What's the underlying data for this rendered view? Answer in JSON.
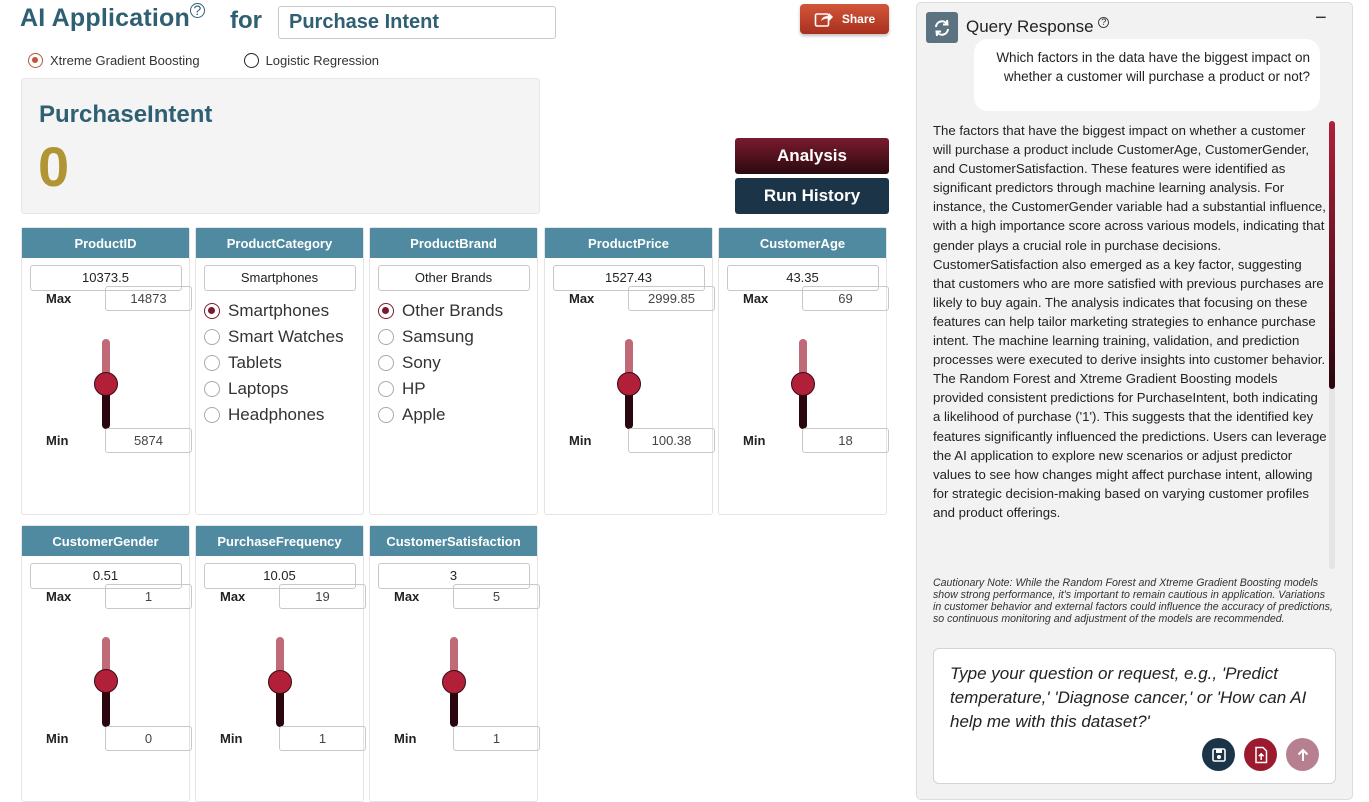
{
  "header": {
    "title": "AI Application",
    "help_glyph": "?",
    "for_label": "for",
    "intent_value": "Purchase Intent",
    "share_label": "Share"
  },
  "models": {
    "option1": "Xtreme Gradient Boosting",
    "option2": "Logistic Regression",
    "selected": "Xtreme Gradient Boosting"
  },
  "result": {
    "label": "PurchaseIntent",
    "value": "0",
    "value_color": "#b19535"
  },
  "actions": {
    "analysis_label": "Analysis",
    "run_history_label": "Run History"
  },
  "common": {
    "max_label": "Max",
    "min_label": "Min"
  },
  "predictors": {
    "product_id": {
      "name": "ProductID",
      "value": "10373.5",
      "max": "14873",
      "min": "5874",
      "level": 0.5
    },
    "product_category": {
      "name": "ProductCategory",
      "value": "Smartphones",
      "options": [
        "Smartphones",
        "Smart Watches",
        "Tablets",
        "Laptops",
        "Headphones"
      ],
      "selected": "Smartphones"
    },
    "product_brand": {
      "name": "ProductBrand",
      "value": "Other Brands",
      "options": [
        "Other Brands",
        "Samsung",
        "Sony",
        "HP",
        "Apple"
      ],
      "selected": "Other Brands"
    },
    "product_price": {
      "name": "ProductPrice",
      "value": "1527.43",
      "max": "2999.85",
      "min": "100.38",
      "level": 0.5
    },
    "customer_age": {
      "name": "CustomerAge",
      "value": "43.35",
      "max": "69",
      "min": "18",
      "level": 0.5
    },
    "customer_gender": {
      "name": "CustomerGender",
      "value": "0.51",
      "max": "1",
      "min": "0",
      "level": 0.51
    },
    "purchase_frequency": {
      "name": "PurchaseFrequency",
      "value": "10.05",
      "max": "19",
      "min": "1",
      "level": 0.5
    },
    "customer_satisfaction": {
      "name": "CustomerSatisfaction",
      "value": "3",
      "max": "5",
      "min": "1",
      "level": 0.5
    }
  },
  "query_panel": {
    "title": "Query Response",
    "help_glyph": "?",
    "minimize_glyph": "−",
    "user_question": "Which factors in the data have the biggest impact on whether a customer will purchase a product or not?",
    "answer": "The factors that have the biggest impact on whether a customer will purchase a product include CustomerAge, CustomerGender, and CustomerSatisfaction. These features were identified as significant predictors through machine learning analysis. For instance, the CustomerGender variable had a substantial influence, with a high importance score across various models, indicating that gender plays a crucial role in purchase decisions. CustomerSatisfaction also emerged as a key factor, suggesting that customers who are more satisfied with previous purchases are likely to buy again. The analysis indicates that focusing on these features can help tailor marketing strategies to enhance purchase intent. The machine learning training, validation, and prediction processes were executed to derive insights into customer behavior. The Random Forest and Xtreme Gradient Boosting models provided consistent predictions for PurchaseIntent, both indicating a likelihood of purchase ('1'). This suggests that the identified key features significantly influenced the predictions. Users can leverage the AI application to explore new scenarios or adjust predictor values to see how changes might affect purchase intent, allowing for strategic decision-making based on varying customer profiles and product offerings.",
    "caution": "Cautionary Note: While the Random Forest and Xtreme Gradient Boosting models show strong performance, it's important to remain cautious in application. Variations in customer behavior and external factors could influence the accuracy of predictions, so continuous monitoring and adjustment of the models are recommended.",
    "input_placeholder": "Type your question or request, e.g., 'Predict temperature,' 'Diagnose cancer,' or 'How can AI help me with this dataset?'"
  },
  "colors": {
    "title": "#2f5f73",
    "card_header": "#4f8aa0",
    "share": "#c0432a",
    "analysis": "#7a1a2e",
    "run_history": "#1c3448",
    "slider_thumb": "#b11f38"
  }
}
